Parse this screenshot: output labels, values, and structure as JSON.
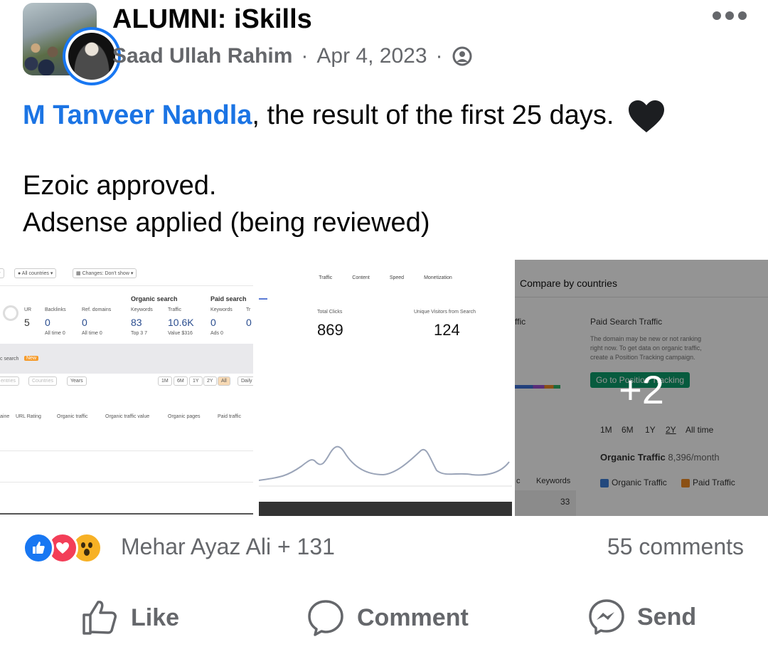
{
  "header": {
    "group_name": "ALUMNI: iSkills",
    "author": "Saad Ullah Rahim",
    "separator": "·",
    "date": "Apr 4, 2023",
    "privacy_icon": "globe-icon",
    "more_icon": "more-dots-icon"
  },
  "post": {
    "mention": "M Tanveer Nandla",
    "text_after_mention": ", the result of the first 25 days.",
    "emoji": "black-heart-icon",
    "line2": "Ezoic approved.",
    "line3": "Adsense applied (being reviewed)"
  },
  "images": {
    "img1": {
      "filter1": "All countries",
      "filter2": "Changes: Don't show",
      "organic_search_label": "Organic search",
      "paid_search_label": "Paid search",
      "cols": [
        "UR",
        "Backlinks",
        "Ref. domains",
        "Keywords",
        "Traffic",
        "Keywords",
        "Tr"
      ],
      "vals": [
        "5",
        "0",
        "0",
        "83",
        "10.6K",
        "0",
        "0"
      ],
      "subs": [
        "All time 0",
        "All time 0",
        "Top 3 7",
        "Value $316",
        "Ads 0"
      ],
      "search_label": "c search",
      "new_badge": "New",
      "filters": [
        "entries",
        "Countries",
        "Years"
      ],
      "periods": [
        "1M",
        "6M",
        "1Y",
        "2Y",
        "All",
        "Daily"
      ],
      "legend": [
        "aine",
        "URL Rating",
        "Organic traffic",
        "Organic traffic value",
        "Organic pages",
        "Paid traffic"
      ]
    },
    "img2": {
      "tabs": [
        "Traffic",
        "Content",
        "Speed",
        "Monetization"
      ],
      "total_clicks_label": "Total Clicks",
      "total_clicks": "869",
      "unique_visitors_label": "Unique Visitors from Search",
      "unique_visitors": "124"
    },
    "img3": {
      "title": "Compare by countries",
      "traffic_label": "ffic",
      "paid_title": "Paid Search Traffic",
      "paid_desc1": "The domain may be new or not ranking",
      "paid_desc2": "right now. To get data on organic traffic,",
      "paid_desc3": "create a Position Tracking campaign.",
      "go_button": "Go to Position Tracking",
      "periods": [
        "1M",
        "6M",
        "1Y",
        "2Y",
        "All time"
      ],
      "organic_traffic_label": "Organic Traffic",
      "organic_traffic_value": "8,396/month",
      "keywords_label": "Keywords",
      "keywords_value": "33",
      "legend1": "Organic Traffic",
      "legend2": "Paid Traffic",
      "col_c": "c",
      "col_k": "K"
    },
    "more_count": "+2"
  },
  "engagement": {
    "reactors": "Mehar Ayaz Ali + 131",
    "comments": "55 comments"
  },
  "actions": {
    "like": "Like",
    "comment": "Comment",
    "send": "Send"
  },
  "colors": {
    "mention": "#1b74e4",
    "secondary_text": "#65676b",
    "like_blue": "#1877f2",
    "love_red": "#f33e58",
    "wow_yellow": "#f7b125"
  }
}
